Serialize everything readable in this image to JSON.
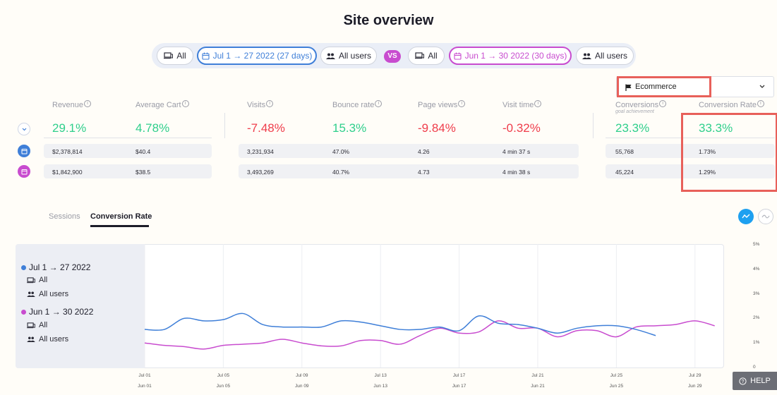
{
  "page_title": "Site overview",
  "filters": {
    "primary": {
      "device": "All",
      "date": "Jul 1 → 27 2022 (27 days)",
      "segment": "All users"
    },
    "vs_label": "VS",
    "secondary": {
      "device": "All",
      "date": "Jun 1 → 30 2022 (30 days)",
      "segment": "All users"
    }
  },
  "goal_dropdown": {
    "selected": "Ecommerce",
    "icon": "flag-icon"
  },
  "metrics": [
    {
      "label": "Revenue",
      "change": "29.1%",
      "trend": "up",
      "current": "$2,378,814",
      "previous": "$1,842,900"
    },
    {
      "label": "Average Cart",
      "change": "4.78%",
      "trend": "up",
      "current": "$40.4",
      "previous": "$38.5"
    },
    {
      "label": "Visits",
      "change": "-7.48%",
      "trend": "down",
      "current": "3,231,934",
      "previous": "3,493,269"
    },
    {
      "label": "Bounce rate",
      "change": "15.3%",
      "trend": "up",
      "current": "47.0%",
      "previous": "40.7%"
    },
    {
      "label": "Page views",
      "change": "-9.84%",
      "trend": "down",
      "current": "4.26",
      "previous": "4.73"
    },
    {
      "label": "Visit time",
      "change": "-0.32%",
      "trend": "down",
      "current": "4 min 37 s",
      "previous": "4 min 38 s"
    },
    {
      "label": "Conversions",
      "sublabel": "goal achievement",
      "change": "23.3%",
      "trend": "up",
      "current": "55,768",
      "previous": "45,224"
    },
    {
      "label": "Conversion Rate",
      "change": "33.3%",
      "trend": "up",
      "current": "1.73%",
      "previous": "1.29%"
    }
  ],
  "tabs": [
    {
      "label": "Sessions",
      "active": false
    },
    {
      "label": "Conversion Rate",
      "active": true
    }
  ],
  "legend": [
    {
      "title": "Jul 1 → 27 2022",
      "color": "#3f7fd8",
      "device": "All",
      "segment": "All users"
    },
    {
      "title": "Jun 1 → 30 2022",
      "color": "#c84ccf",
      "device": "All",
      "segment": "All users"
    }
  ],
  "help_label": "HELP",
  "colors": {
    "primary": "#3f7fd8",
    "secondary": "#c84ccf",
    "positive": "#2fcf8c",
    "negative": "#ef3d4b",
    "highlight": "#e8605a"
  },
  "chart_data": {
    "type": "line",
    "xlabel": "",
    "ylabel": "",
    "y_unit": "%",
    "ylim": [
      0,
      5
    ],
    "y_ticks": [
      "0",
      "1%",
      "2%",
      "3%",
      "4%",
      "5%"
    ],
    "x_ticks_primary": [
      "Jul 01",
      "Jul 05",
      "Jul 09",
      "Jul 13",
      "Jul 17",
      "Jul 21",
      "Jul 25",
      "Jul 29"
    ],
    "x_ticks_secondary": [
      "Jun 01",
      "Jun 05",
      "Jun 09",
      "Jun 13",
      "Jun 17",
      "Jun 21",
      "Jun 25",
      "Jun 29"
    ],
    "grid": true,
    "series": [
      {
        "name": "Jul 1 → 27 2022",
        "x": [
          1,
          2,
          3,
          4,
          5,
          6,
          7,
          8,
          9,
          10,
          11,
          12,
          13,
          14,
          15,
          16,
          17,
          18,
          19,
          20,
          21,
          22,
          23,
          24,
          25,
          26,
          27
        ],
        "values": [
          1.55,
          1.55,
          2.0,
          1.9,
          1.95,
          2.2,
          1.75,
          1.65,
          1.65,
          1.65,
          1.9,
          1.85,
          1.7,
          1.55,
          1.55,
          1.65,
          1.5,
          2.1,
          1.8,
          1.75,
          1.6,
          1.4,
          1.6,
          1.7,
          1.7,
          1.55,
          1.3
        ]
      },
      {
        "name": "Jun 1 → 30 2022",
        "x": [
          1,
          2,
          3,
          4,
          5,
          6,
          7,
          8,
          9,
          10,
          11,
          12,
          13,
          14,
          15,
          16,
          17,
          18,
          19,
          20,
          21,
          22,
          23,
          24,
          25,
          26,
          27,
          28,
          29,
          30
        ],
        "values": [
          1.0,
          0.9,
          0.85,
          0.75,
          0.9,
          0.95,
          1.0,
          1.15,
          1.0,
          0.88,
          0.88,
          1.1,
          1.1,
          0.95,
          1.3,
          1.6,
          1.4,
          1.45,
          1.9,
          1.6,
          1.6,
          1.25,
          1.5,
          1.5,
          1.25,
          1.65,
          1.7,
          1.75,
          1.9,
          1.7
        ]
      }
    ]
  }
}
